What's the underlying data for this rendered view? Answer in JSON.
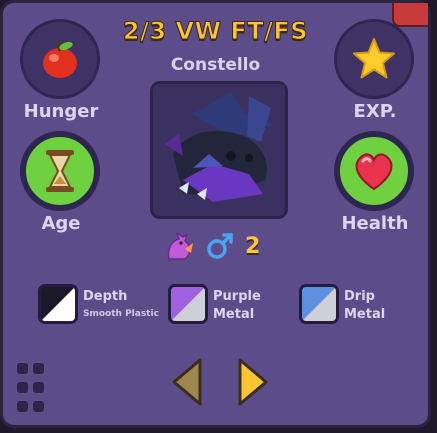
{
  "header": {
    "title": "2/3 VW FT/FS",
    "pet_name": "Constello"
  },
  "stats": {
    "hunger": {
      "label": "Hunger",
      "icon": "apple-icon"
    },
    "exp": {
      "label": "EXP.",
      "icon": "star-icon"
    },
    "age": {
      "label": "Age",
      "icon": "hourglass-icon"
    },
    "health": {
      "label": "Health",
      "icon": "heart-icon"
    }
  },
  "pet": {
    "image": "black-purple-dragon",
    "species_icon": "dragon-icon",
    "gender_icon": "male-icon",
    "level": "2"
  },
  "materials": [
    {
      "name": "Depth",
      "sub": "Smooth Plastic",
      "colors": [
        "#1c1a2a",
        "#ffffff"
      ]
    },
    {
      "name": "Purple",
      "sub": "Metal",
      "colors": [
        "#a060e0",
        "#cfcfd8"
      ]
    },
    {
      "name": "Drip",
      "sub": "Metal",
      "colors": [
        "#5f8fe0",
        "#cfcfd8"
      ]
    }
  ],
  "nav": {
    "grid_icon": "grid-icon",
    "prev_icon": "arrow-left-icon",
    "next_icon": "arrow-right-icon"
  },
  "colors": {
    "panel": "#5c4d8a",
    "title": "#ffc531",
    "stat_fill": "#6fd13f",
    "close": "#c93a3a"
  }
}
